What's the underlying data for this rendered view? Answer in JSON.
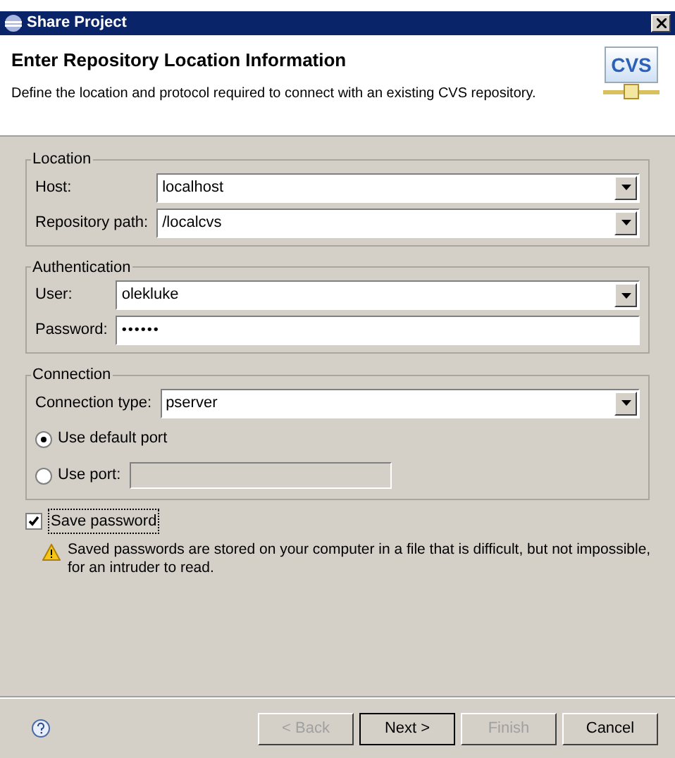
{
  "window": {
    "title": "Share Project"
  },
  "header": {
    "title": "Enter Repository Location Information",
    "description": "Define the location and protocol required to connect with an existing CVS repository.",
    "logo": "CVS"
  },
  "groups": [
    {
      "title": "Location",
      "fields": [
        {
          "kind": "combo",
          "label": "Host:",
          "value": "localhost"
        },
        {
          "kind": "combo",
          "label": "Repository path:",
          "value": "/localcvs"
        }
      ]
    },
    {
      "title": "Authentication",
      "fields": [
        {
          "kind": "combo",
          "label": "User:",
          "value": "olekluke"
        },
        {
          "kind": "password",
          "label": "Password:",
          "value": "••••••"
        }
      ]
    },
    {
      "title": "Connection",
      "fields": [
        {
          "kind": "combo",
          "label": "Connection type:",
          "value": "pserver"
        },
        {
          "kind": "radio",
          "label": "Use default port",
          "selected": true
        },
        {
          "kind": "radio_input",
          "label": "Use port:",
          "selected": false,
          "disabled": true
        }
      ]
    }
  ],
  "save_password": {
    "label": "Save password",
    "checked": true
  },
  "warning": "Saved passwords are stored on your computer in a file that is difficult, but not impossible, for an intruder to read.",
  "buttons": [
    {
      "label": "< Back",
      "disabled": true,
      "default": false
    },
    {
      "label": "Next >",
      "disabled": false,
      "default": true
    },
    {
      "label": "Finish",
      "disabled": true,
      "default": false
    },
    {
      "label": "Cancel",
      "disabled": false,
      "default": false
    }
  ]
}
